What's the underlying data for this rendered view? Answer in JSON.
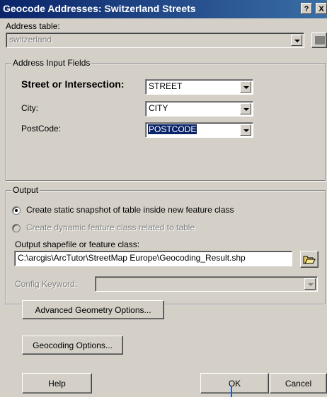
{
  "window": {
    "title": "Geocode Addresses:  Switzerland Streets",
    "help_button": "?",
    "close_button": "X"
  },
  "address_table": {
    "label": "Address table:",
    "value": "switzerland"
  },
  "address_input": {
    "group_title": "Address Input Fields",
    "fields": [
      {
        "label": "Street or Intersection:",
        "value": "STREET"
      },
      {
        "label": "City:",
        "value": "CITY"
      },
      {
        "label": "PostCode:",
        "value": "POSTCODE"
      }
    ]
  },
  "output": {
    "group_title": "Output",
    "radio_static": "Create static snapshot of table inside new feature class",
    "radio_dynamic": "Create dynamic feature class related to table",
    "shapefile_label": "Output shapefile or feature class:",
    "shapefile_value": "C:\\arcgis\\ArcTutor\\StreetMap Europe\\Geocoding_Result.shp",
    "config_label": "Config Keyword:",
    "advanced_button": "Advanced Geometry Options..."
  },
  "geocoding_options_button": "Geocoding Options...",
  "footer": {
    "help": "Help",
    "ok": "OK",
    "cancel": "Cancel"
  },
  "colors": {
    "titlebar": "#0a246a",
    "selection": "#0a246a",
    "face": "#d4d0c8"
  }
}
